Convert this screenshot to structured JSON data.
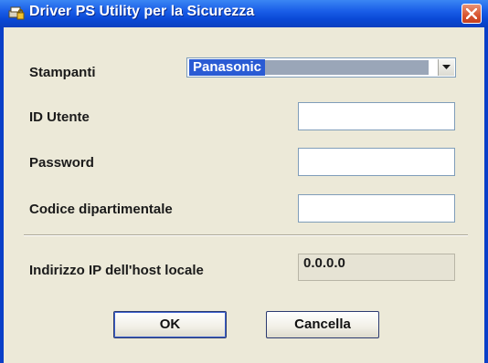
{
  "window": {
    "title": "Driver PS Utility per la Sicurezza",
    "icon": "printer-lock-icon",
    "close_icon": "close-icon"
  },
  "form": {
    "printer_label": "Stampanti",
    "printer_value": "Panasonic",
    "user_id_label": "ID Utente",
    "user_id_value": "",
    "password_label": "Password",
    "password_value": "",
    "department_code_label": "Codice dipartimentale",
    "department_code_value": "",
    "ip_label": "Indirizzo IP dell'host locale",
    "ip_value": "0.0.0.0"
  },
  "buttons": {
    "ok_label": "OK",
    "cancel_label": "Cancella"
  },
  "colors": {
    "titlebar": "#0a49d6",
    "dialog_bg": "#ece9d8",
    "selection": "#2a5bd4",
    "close_button": "#d8542f"
  }
}
